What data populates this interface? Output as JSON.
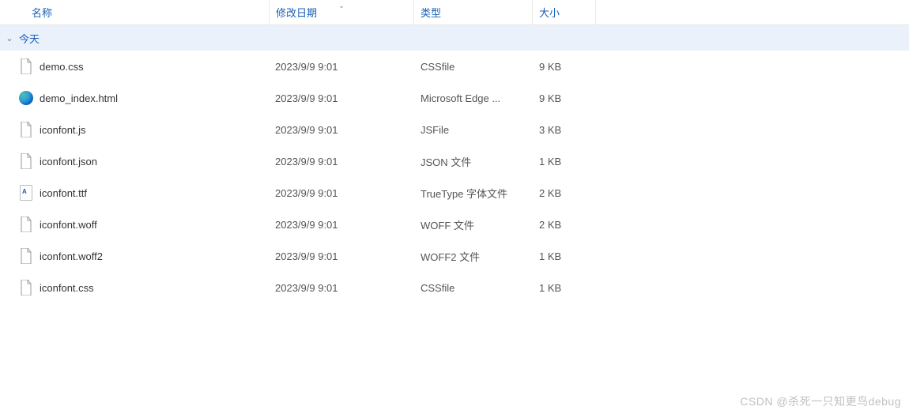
{
  "columns": {
    "name": "名称",
    "date": "修改日期",
    "type": "类型",
    "size": "大小"
  },
  "group": {
    "label": "今天"
  },
  "files": [
    {
      "name": "demo.css",
      "date": "2023/9/9 9:01",
      "type": "CSSfile",
      "size": "9 KB",
      "icon": "generic"
    },
    {
      "name": "demo_index.html",
      "date": "2023/9/9 9:01",
      "type": "Microsoft Edge ...",
      "size": "9 KB",
      "icon": "edge"
    },
    {
      "name": "iconfont.js",
      "date": "2023/9/9 9:01",
      "type": "JSFile",
      "size": "3 KB",
      "icon": "generic"
    },
    {
      "name": "iconfont.json",
      "date": "2023/9/9 9:01",
      "type": "JSON 文件",
      "size": "1 KB",
      "icon": "generic"
    },
    {
      "name": "iconfont.ttf",
      "date": "2023/9/9 9:01",
      "type": "TrueType 字体文件",
      "size": "2 KB",
      "icon": "ttf"
    },
    {
      "name": "iconfont.woff",
      "date": "2023/9/9 9:01",
      "type": "WOFF 文件",
      "size": "2 KB",
      "icon": "generic"
    },
    {
      "name": "iconfont.woff2",
      "date": "2023/9/9 9:01",
      "type": "WOFF2 文件",
      "size": "1 KB",
      "icon": "generic"
    },
    {
      "name": "iconfont.css",
      "date": "2023/9/9 9:01",
      "type": "CSSfile",
      "size": "1 KB",
      "icon": "generic"
    }
  ],
  "watermark": "CSDN @杀死一只知更鸟debug"
}
